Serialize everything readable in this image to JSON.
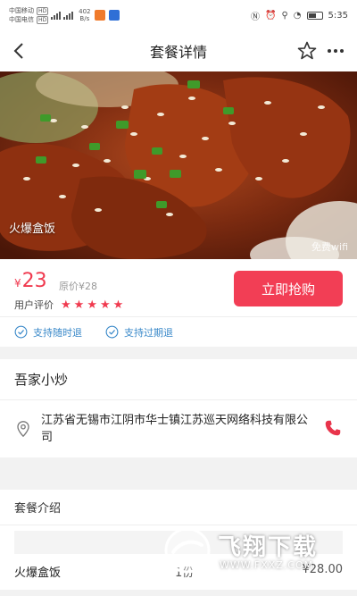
{
  "status_bar": {
    "carrier1": "中国移动",
    "carrier2": "中国电信",
    "hd": "HD",
    "net_speed_value": "402",
    "net_speed_unit": "B/s",
    "time": "5:35"
  },
  "nav": {
    "title": "套餐详情"
  },
  "hero": {
    "caption": "火爆盒饭",
    "wifi_note": "免费wifi"
  },
  "price_card": {
    "currency": "¥",
    "price": "23",
    "original_price": "原价¥28",
    "rating_label": "用户评价",
    "rating_stars": 5,
    "buy_button": "立即抢购"
  },
  "guarantees": [
    "支持随时退",
    "支持过期退"
  ],
  "shop": {
    "name": "吾家小炒",
    "address": "江苏省无锡市江阴市华士镇江苏巡天网络科技有限公司"
  },
  "package_section": {
    "title": "套餐介绍",
    "items": [
      {
        "name": "火爆盒饭",
        "qty": "1份",
        "price": "¥28.00"
      }
    ]
  },
  "watermark": {
    "text": "飞翔下载",
    "url": "WWW.FXXZ.COM"
  },
  "colors": {
    "accent_red": "#f23e55",
    "guarantee_blue": "#3a89c9"
  }
}
